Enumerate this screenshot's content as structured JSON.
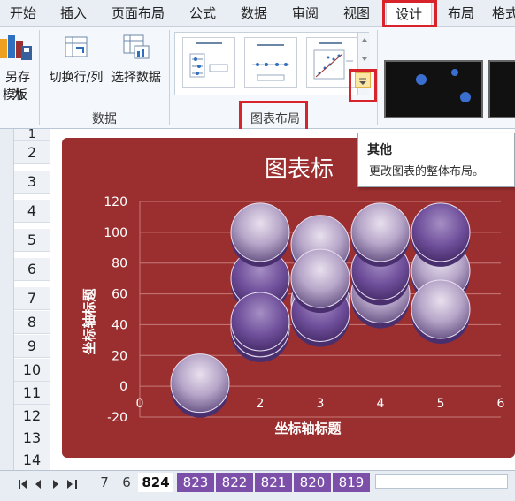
{
  "ribbon_tabs": [
    "开始",
    "插入",
    "页面布局",
    "公式",
    "数据",
    "审阅",
    "视图",
    "设计",
    "布局",
    "格式"
  ],
  "active_tab": "设计",
  "ribbon": {
    "save_as_template_label": "另存为",
    "save_as_template_label2": "模板",
    "switch_row_col_label": "切换行/列",
    "select_data_label": "选择数据",
    "data_group_label": "数据",
    "chart_layouts_group_label": "图表布局"
  },
  "tooltip": {
    "title": "其他",
    "description": "更改图表的整体布局。"
  },
  "row_numbers": [
    "1",
    "2",
    "3",
    "4",
    "5",
    "6",
    "7",
    "8",
    "9",
    "10",
    "11",
    "12",
    "13",
    "14"
  ],
  "chart": {
    "title": "图表标",
    "x_axis_title": "坐标轴标题",
    "y_axis_title": "坐标轴标题"
  },
  "sheet_tabs": [
    "7",
    "6",
    "824",
    "823",
    "822",
    "821",
    "820",
    "819"
  ],
  "active_sheet": "824",
  "colors": {
    "accent_red": "#d9232a",
    "chart_bg": "#9b2f2f",
    "sheet_tab_purple": "#7c4fa8"
  },
  "chart_data": {
    "type": "scatter",
    "title": "图表标",
    "xlabel": "坐标轴标题",
    "ylabel": "坐标轴标题",
    "xlim": [
      0,
      6
    ],
    "ylim": [
      -20,
      120
    ],
    "x_ticks": [
      "0",
      "1",
      "2",
      "3",
      "4",
      "5",
      "6"
    ],
    "y_ticks": [
      "120",
      "100",
      "80",
      "60",
      "40",
      "20",
      "0",
      "-20"
    ],
    "grid": true,
    "series": [
      {
        "points": [
          {
            "x": 1,
            "y": 2
          },
          {
            "x": 2,
            "y": 70
          },
          {
            "x": 2,
            "y": 100
          },
          {
            "x": 2,
            "y": 38
          },
          {
            "x": 2,
            "y": 42
          },
          {
            "x": 3,
            "y": 92
          },
          {
            "x": 3,
            "y": 55
          },
          {
            "x": 3,
            "y": 48
          },
          {
            "x": 3,
            "y": 70
          },
          {
            "x": 4,
            "y": 60
          },
          {
            "x": 4,
            "y": 75
          },
          {
            "x": 4,
            "y": 100
          },
          {
            "x": 5,
            "y": 75
          },
          {
            "x": 5,
            "y": 100
          },
          {
            "x": 5,
            "y": 50
          }
        ]
      }
    ]
  }
}
